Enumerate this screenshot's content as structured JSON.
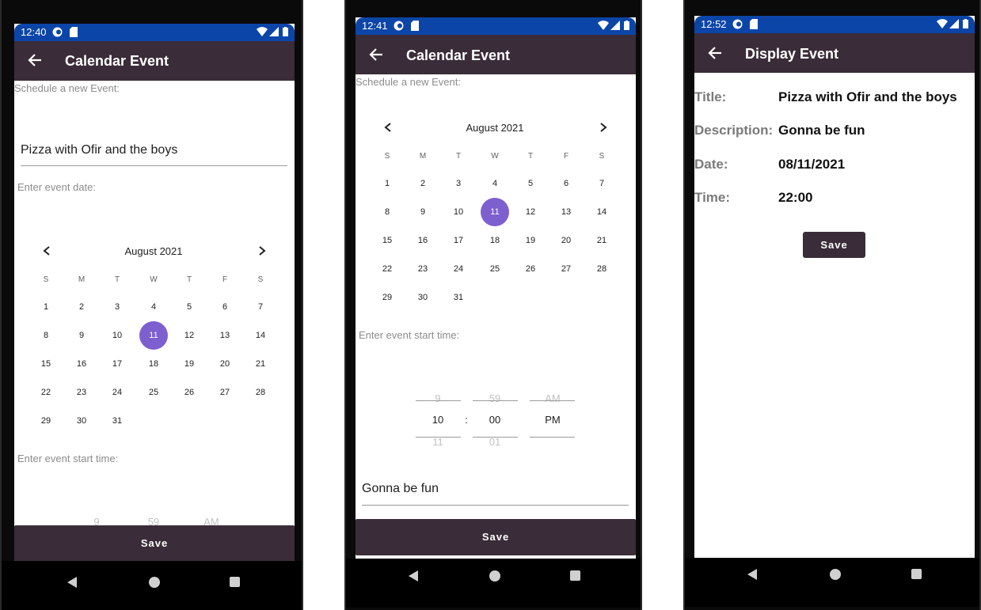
{
  "status": {
    "time1": "12:40",
    "time2": "12:41",
    "time3": "12:52"
  },
  "calendar_screen": {
    "app_title": "Calendar Event",
    "schedule_label": "Schedule a new Event:",
    "title_value": "Pizza with Ofir and the boys",
    "date_label": "Enter event date:",
    "start_time_label": "Enter event start time:",
    "description_value": "Gonna be fun",
    "save_label": "Save"
  },
  "calendar": {
    "month_label": "August 2021",
    "weekdays": [
      "S",
      "M",
      "T",
      "W",
      "T",
      "F",
      "S"
    ],
    "weeks": [
      [
        "1",
        "2",
        "3",
        "4",
        "5",
        "6",
        "7"
      ],
      [
        "8",
        "9",
        "10",
        "11",
        "12",
        "13",
        "14"
      ],
      [
        "15",
        "16",
        "17",
        "18",
        "19",
        "20",
        "21"
      ],
      [
        "22",
        "23",
        "24",
        "25",
        "26",
        "27",
        "28"
      ],
      [
        "29",
        "30",
        "31",
        "",
        "",
        "",
        ""
      ]
    ],
    "selected_day": "11"
  },
  "time_picker": {
    "hour_prev": "9",
    "hour": "10",
    "hour_next": "11",
    "separator": ":",
    "minute_prev": "59",
    "minute": "00",
    "minute_next": "01",
    "ampm_prev": "AM",
    "ampm": "PM",
    "partial_hour": "9",
    "partial_minute": "59",
    "partial_ampm": "AM"
  },
  "display_screen": {
    "app_title": "Display Event",
    "title_label": "Title:",
    "title_value": "Pizza with Ofir and the boys",
    "description_label": "Description:",
    "description_value": "Gonna be fun",
    "date_label": "Date:",
    "date_value": "08/11/2021",
    "time_label": "Time:",
    "time_value": "22:00",
    "save_label": "Save"
  },
  "colors": {
    "status_bar": "#0b45a8",
    "app_bar": "#3a2c38",
    "selected_day": "#7e5fcf"
  }
}
